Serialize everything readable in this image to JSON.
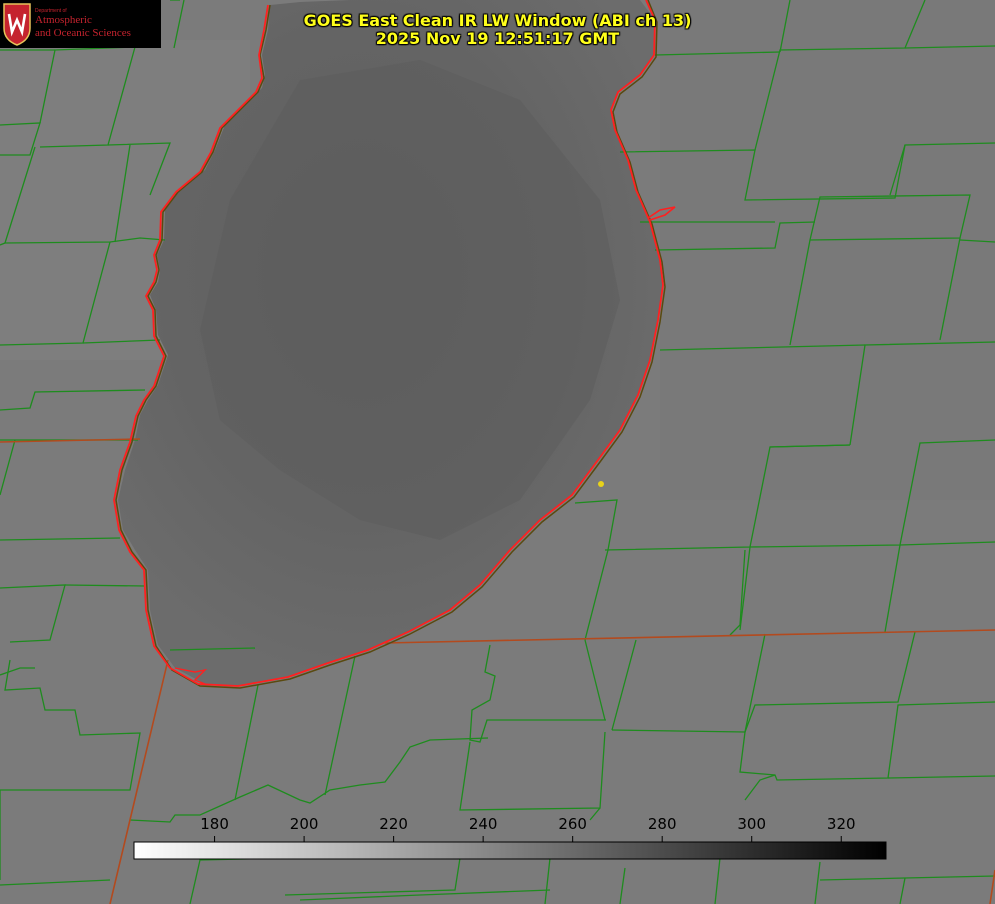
{
  "title": {
    "line1": "GOES East Clean IR LW Window (ABI ch 13)",
    "line2": "2025 Nov 19 12:51:17 GMT"
  },
  "logo": {
    "department": "Department of",
    "line1": "Atmospheric",
    "line2": "and Oceanic Sciences",
    "icon": "uw-crest-icon"
  },
  "colorbar": {
    "ticks": [
      "180",
      "200",
      "220",
      "240",
      "260",
      "280",
      "300",
      "320"
    ],
    "tick_values": [
      180,
      200,
      220,
      240,
      260,
      280,
      300,
      320
    ],
    "range": [
      162,
      330
    ],
    "gradient": [
      "#ffffff",
      "#000000"
    ]
  },
  "colors": {
    "county_lines": "#1e8c1e",
    "state_lines": "#b34a1e",
    "shoreline": "#ff2020",
    "marker": "#e8d21a",
    "title_text": "#ffff1a"
  }
}
